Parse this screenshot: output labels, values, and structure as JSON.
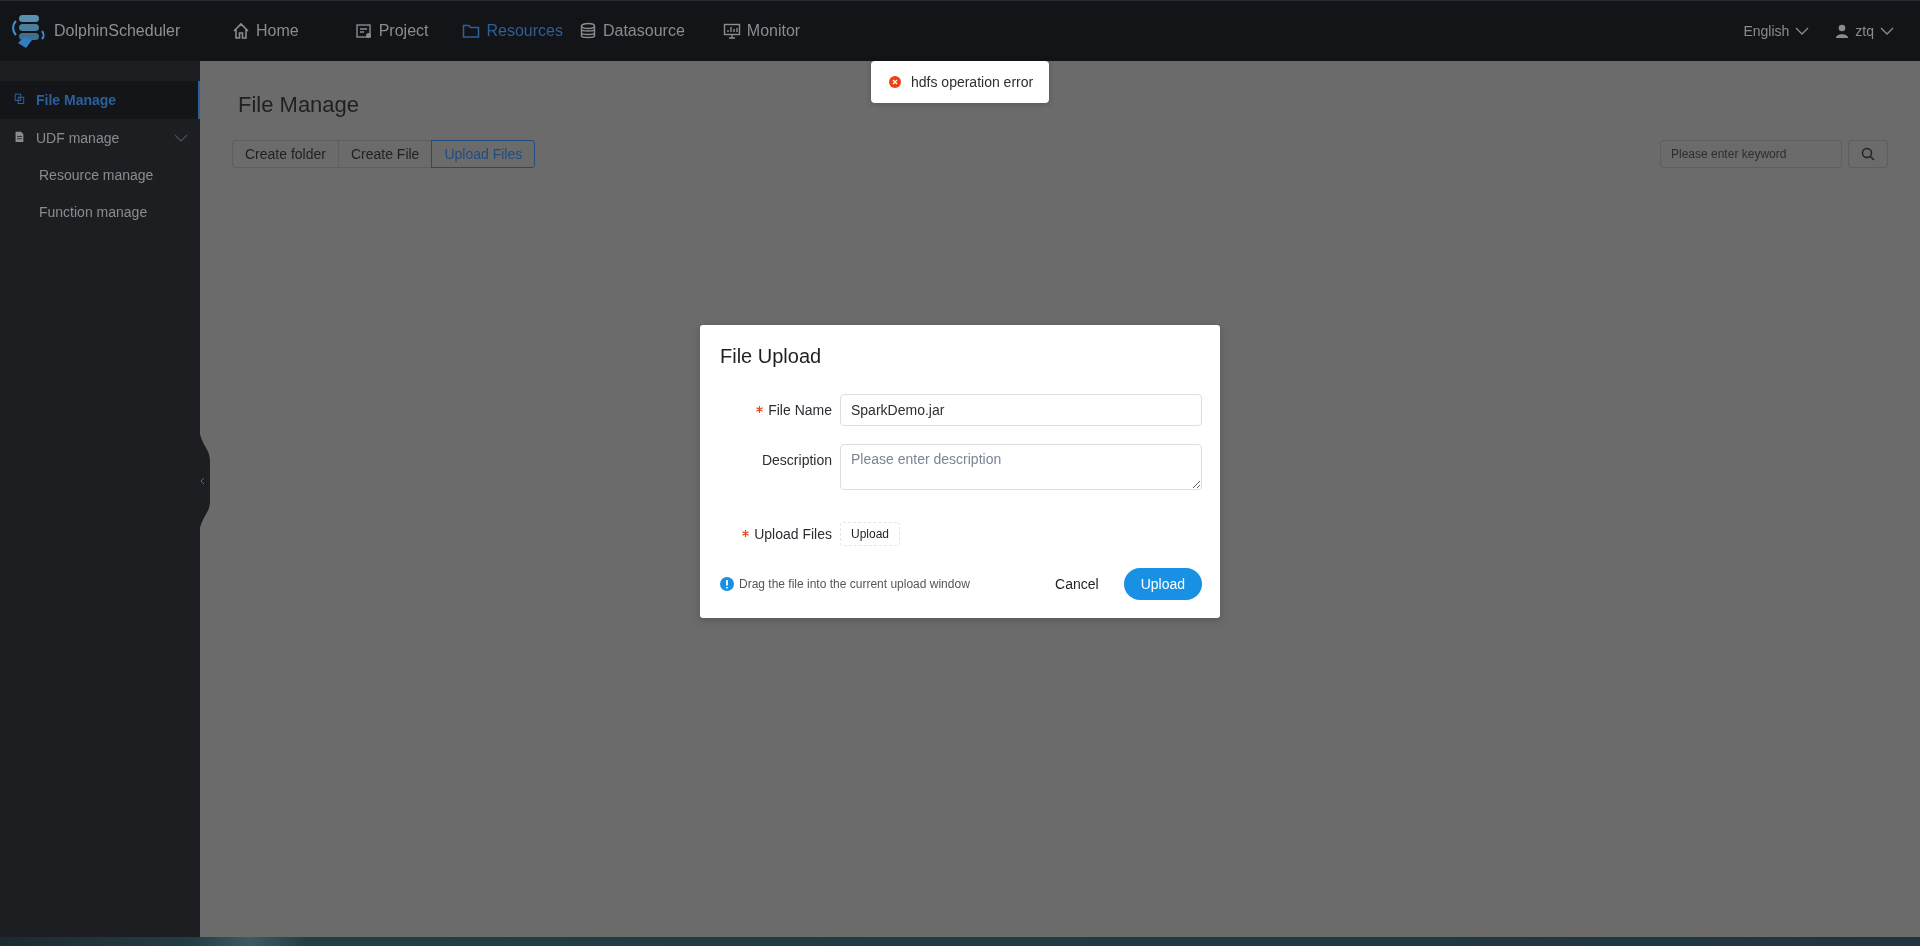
{
  "app": {
    "name": "DolphinScheduler"
  },
  "nav": [
    {
      "label": "Home",
      "selected": false
    },
    {
      "label": "Project",
      "selected": false
    },
    {
      "label": "Resources",
      "selected": true
    },
    {
      "label": "Datasource",
      "selected": false
    },
    {
      "label": "Monitor",
      "selected": false
    }
  ],
  "language": {
    "label": "English"
  },
  "user": {
    "name": "ztq"
  },
  "sidebar": {
    "items": [
      {
        "label": "File Manage",
        "selected": true
      },
      {
        "label": "UDF manage",
        "selected": false,
        "expanded": true,
        "children": [
          {
            "label": "Resource manage",
            "selected": false
          },
          {
            "label": "Function manage",
            "selected": false
          }
        ]
      }
    ]
  },
  "page": {
    "title": "File Manage",
    "actions": [
      {
        "label": "Create folder",
        "selected": false
      },
      {
        "label": "Create File",
        "selected": false
      },
      {
        "label": "Upload Files",
        "selected": true
      }
    ],
    "search": {
      "placeholder": "Please enter keyword"
    }
  },
  "toast": {
    "kind": "error",
    "message": "hdfs operation error"
  },
  "dialog": {
    "title": "File Upload",
    "fields": [
      {
        "kind": "text",
        "label": "File Name",
        "required": true,
        "value": "SparkDemo.jar"
      },
      {
        "kind": "textarea",
        "label": "Description",
        "required": false,
        "placeholder": "Please enter description"
      },
      {
        "kind": "upload",
        "label": "Upload Files",
        "required": true,
        "button": "Upload"
      }
    ],
    "hint": "Drag the file into the current upload window",
    "buttons": [
      {
        "label": "Cancel",
        "kind": "text"
      },
      {
        "label": "Upload",
        "kind": "primary"
      }
    ]
  }
}
